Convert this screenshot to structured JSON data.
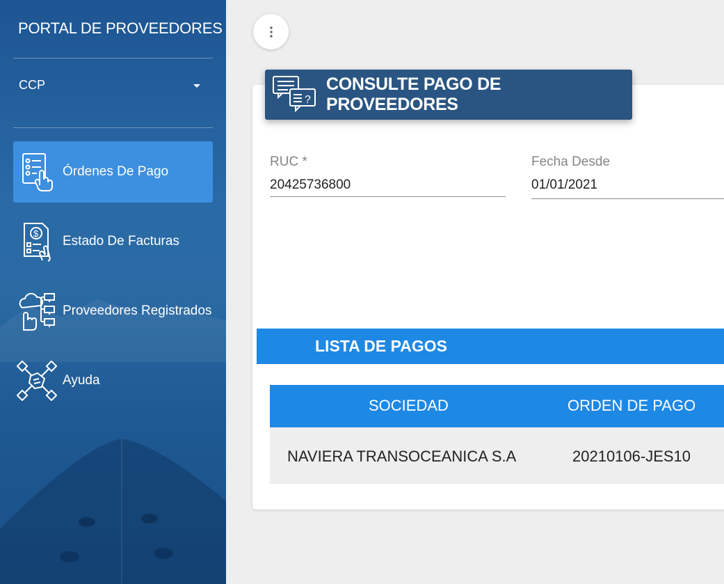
{
  "sidebar": {
    "brand": "PORTAL DE PROVEEDORES",
    "company": "CCP",
    "items": [
      {
        "label": "Órdenes De Pago",
        "icon": "checklist-hand-icon",
        "active": true
      },
      {
        "label": "Estado De Facturas",
        "icon": "invoice-dollar-icon",
        "active": false
      },
      {
        "label": "Proveedores Registrados",
        "icon": "cloud-network-icon",
        "active": false
      },
      {
        "label": "Ayuda",
        "icon": "handshake-icon",
        "active": false
      }
    ]
  },
  "header": {
    "title": "CONSULTE PAGO DE PROVEEDORES",
    "icon": "chat-bubbles-icon"
  },
  "form": {
    "ruc_label": "RUC *",
    "ruc_value": "20425736800",
    "fecha_desde_label": "Fecha Desde",
    "fecha_desde_value": "01/01/2021"
  },
  "list": {
    "title": "LISTA DE PAGOS",
    "columns": [
      "SOCIEDAD",
      "ORDEN DE PAGO"
    ],
    "rows": [
      [
        "NAVIERA TRANSOCEANICA S.A",
        "20210106-JES10"
      ]
    ]
  },
  "colors": {
    "sidebar": "#1d5592",
    "active_item": "#3d8fe0",
    "header": "#2a5582",
    "table_header": "#1e88e5"
  }
}
